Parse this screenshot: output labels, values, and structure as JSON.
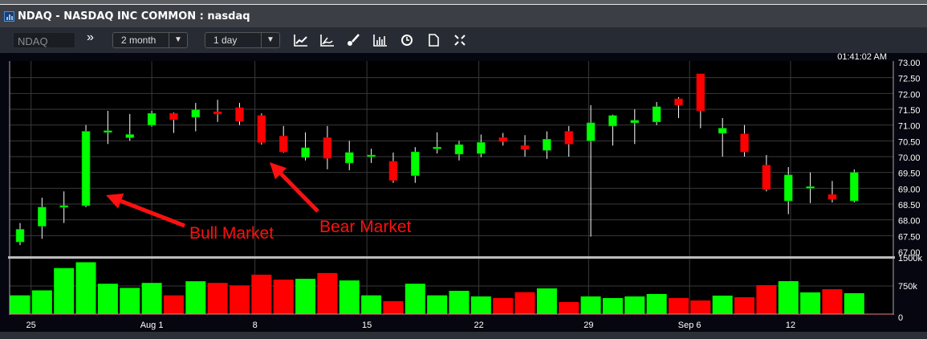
{
  "window": {
    "title": "NDAQ - NASDAQ INC COMMON : nasdaq"
  },
  "toolbar": {
    "symbol_value": "NDAQ",
    "period_value": "2 month",
    "interval_value": "1 day",
    "icons": [
      "expand-double-chevron-icon",
      "line-chart-icon",
      "indicator-chart-icon",
      "brush-draw-icon",
      "volume-bars-icon",
      "clock-icon",
      "document-icon",
      "fullscreen-icon"
    ]
  },
  "colors": {
    "up": "#00ff00",
    "down": "#ff0000",
    "annotation": "#ff1010",
    "background": "#000000",
    "grid": "#3a3a3a"
  },
  "chart_data": {
    "type": "candlestick",
    "timestamp": "01:41:02 AM",
    "y_axis": {
      "ylim": [
        67.0,
        73.0
      ],
      "ticks": [
        "73.00",
        "72.50",
        "72.00",
        "71.50",
        "71.00",
        "70.50",
        "70.00",
        "69.50",
        "69.00",
        "68.50",
        "68.00",
        "67.50",
        "67.00"
      ]
    },
    "volume_axis": {
      "ylim": [
        0,
        1500
      ],
      "ticks": [
        "1500k",
        "750k",
        "0"
      ]
    },
    "x_ticks": [
      {
        "label": "25",
        "index": 0.5
      },
      {
        "label": "Aug 1",
        "index": 6
      },
      {
        "label": "8",
        "index": 10.7
      },
      {
        "label": "15",
        "index": 15.8
      },
      {
        "label": "22",
        "index": 20.9
      },
      {
        "label": "29",
        "index": 25.9
      },
      {
        "label": "Sep 6",
        "index": 30.5
      },
      {
        "label": "12",
        "index": 35.1
      }
    ],
    "candles": [
      {
        "o": 67.3,
        "h": 67.9,
        "l": 67.2,
        "c": 67.7,
        "v": 500
      },
      {
        "o": 67.8,
        "h": 68.7,
        "l": 67.4,
        "c": 68.4,
        "v": 633
      },
      {
        "o": 68.4,
        "h": 68.9,
        "l": 67.9,
        "c": 68.45,
        "v": 1228
      },
      {
        "o": 68.45,
        "h": 71.0,
        "l": 68.4,
        "c": 70.8,
        "v": 1383
      },
      {
        "o": 70.78,
        "h": 71.45,
        "l": 70.4,
        "c": 70.82,
        "v": 810
      },
      {
        "o": 70.6,
        "h": 71.35,
        "l": 70.5,
        "c": 70.7,
        "v": 699
      },
      {
        "o": 71.0,
        "h": 71.45,
        "l": 70.95,
        "c": 71.37,
        "v": 832
      },
      {
        "o": 71.37,
        "h": 71.4,
        "l": 70.75,
        "c": 71.17,
        "v": 500,
        "down": true
      },
      {
        "o": 71.25,
        "h": 71.7,
        "l": 70.8,
        "c": 71.48,
        "v": 876
      },
      {
        "o": 71.42,
        "h": 71.8,
        "l": 71.1,
        "c": 71.35,
        "v": 832,
        "down": true
      },
      {
        "o": 71.55,
        "h": 71.7,
        "l": 71.0,
        "c": 71.12,
        "v": 766,
        "down": true
      },
      {
        "o": 71.3,
        "h": 71.37,
        "l": 70.38,
        "c": 70.45,
        "v": 1052,
        "down": true
      },
      {
        "o": 70.65,
        "h": 70.97,
        "l": 70.12,
        "c": 70.15,
        "v": 920,
        "down": true
      },
      {
        "o": 69.98,
        "h": 70.77,
        "l": 69.88,
        "c": 70.28,
        "v": 942
      },
      {
        "o": 70.6,
        "h": 70.97,
        "l": 69.6,
        "c": 69.95,
        "v": 1096,
        "down": true
      },
      {
        "o": 69.8,
        "h": 70.5,
        "l": 69.57,
        "c": 70.13,
        "v": 898
      },
      {
        "o": 70.0,
        "h": 70.25,
        "l": 69.8,
        "c": 70.05,
        "v": 500
      },
      {
        "o": 69.85,
        "h": 70.13,
        "l": 69.17,
        "c": 69.25,
        "v": 346,
        "down": true
      },
      {
        "o": 69.4,
        "h": 70.3,
        "l": 69.17,
        "c": 70.15,
        "v": 810
      },
      {
        "o": 70.25,
        "h": 70.77,
        "l": 70.1,
        "c": 70.3,
        "v": 500
      },
      {
        "o": 70.08,
        "h": 70.5,
        "l": 69.88,
        "c": 70.38,
        "v": 621
      },
      {
        "o": 70.1,
        "h": 70.7,
        "l": 69.98,
        "c": 70.45,
        "v": 471
      },
      {
        "o": 70.6,
        "h": 70.75,
        "l": 70.35,
        "c": 70.48,
        "v": 428,
        "down": true
      },
      {
        "o": 70.35,
        "h": 70.68,
        "l": 70.0,
        "c": 70.23,
        "v": 585,
        "down": true
      },
      {
        "o": 70.2,
        "h": 70.8,
        "l": 69.93,
        "c": 70.55,
        "v": 686
      },
      {
        "o": 70.8,
        "h": 70.97,
        "l": 70.0,
        "c": 70.4,
        "v": 321,
        "down": true
      },
      {
        "o": 70.5,
        "h": 71.63,
        "l": 67.47,
        "c": 71.07,
        "v": 471
      },
      {
        "o": 70.97,
        "h": 71.33,
        "l": 70.35,
        "c": 71.3,
        "v": 428
      },
      {
        "o": 71.07,
        "h": 71.5,
        "l": 70.4,
        "c": 71.15,
        "v": 471
      },
      {
        "o": 71.1,
        "h": 71.73,
        "l": 71.0,
        "c": 71.58,
        "v": 536
      },
      {
        "o": 71.83,
        "h": 71.88,
        "l": 71.22,
        "c": 71.63,
        "v": 428,
        "down": true
      },
      {
        "o": 72.62,
        "h": 72.62,
        "l": 70.9,
        "c": 71.45,
        "v": 364,
        "down": true
      },
      {
        "o": 70.74,
        "h": 71.22,
        "l": 70.0,
        "c": 70.9,
        "v": 493
      },
      {
        "o": 70.72,
        "h": 71.0,
        "l": 70.0,
        "c": 70.15,
        "v": 450,
        "down": true
      },
      {
        "o": 69.73,
        "h": 70.05,
        "l": 68.9,
        "c": 68.96,
        "v": 771,
        "down": true
      },
      {
        "o": 68.6,
        "h": 69.67,
        "l": 68.18,
        "c": 69.42,
        "v": 879
      },
      {
        "o": 69.0,
        "h": 69.5,
        "l": 68.53,
        "c": 69.05,
        "v": 579
      },
      {
        "o": 68.8,
        "h": 69.23,
        "l": 68.55,
        "c": 68.65,
        "v": 664,
        "down": true
      },
      {
        "o": 68.6,
        "h": 69.6,
        "l": 68.55,
        "c": 69.5,
        "v": 557
      }
    ],
    "trailing_volume": {
      "v": 10,
      "down": true
    },
    "annotations": [
      {
        "text": "Bull Market",
        "points_to_index": 3
      },
      {
        "text": "Bear Market",
        "points_to_index": 12
      }
    ]
  }
}
